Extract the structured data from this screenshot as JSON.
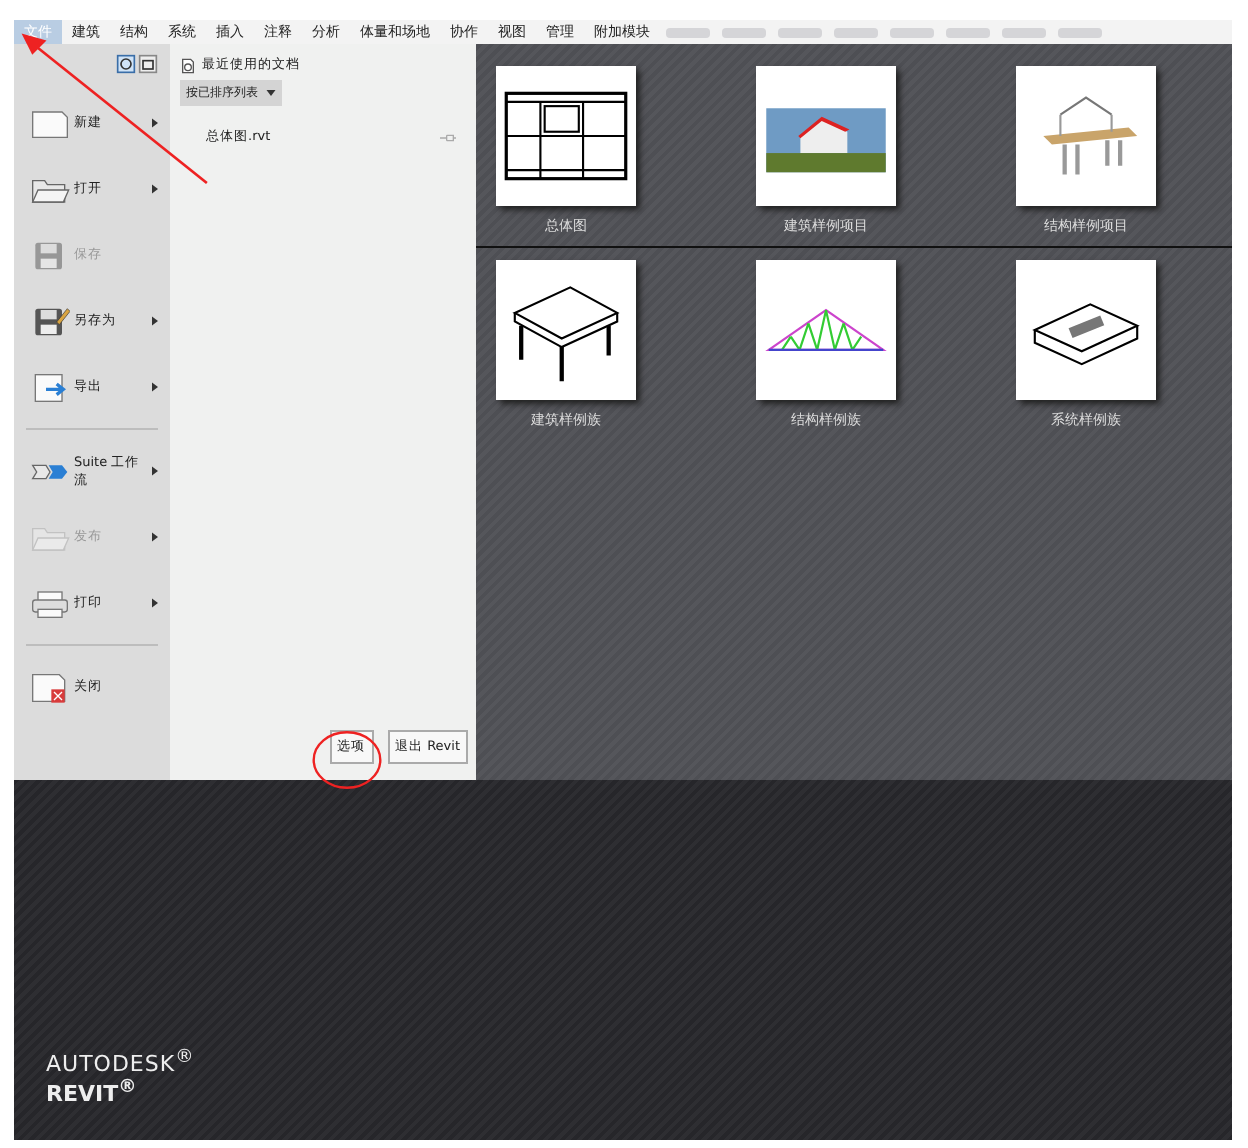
{
  "ribbon": {
    "tabs": [
      {
        "label": "文件",
        "selected": true
      },
      {
        "label": "建筑",
        "selected": false
      },
      {
        "label": "结构",
        "selected": false
      },
      {
        "label": "系统",
        "selected": false
      },
      {
        "label": "插入",
        "selected": false
      },
      {
        "label": "注释",
        "selected": false
      },
      {
        "label": "分析",
        "selected": false
      },
      {
        "label": "体量和场地",
        "selected": false
      },
      {
        "label": "协作",
        "selected": false
      },
      {
        "label": "视图",
        "selected": false
      },
      {
        "label": "管理",
        "selected": false
      },
      {
        "label": "附加模块",
        "selected": false
      }
    ]
  },
  "app_menu": {
    "groups": [
      [
        {
          "label": "新建",
          "disabled": false,
          "submenu": true
        },
        {
          "label": "打开",
          "disabled": false,
          "submenu": true
        },
        {
          "label": "保存",
          "disabled": true,
          "submenu": false
        },
        {
          "label": "另存为",
          "disabled": false,
          "submenu": true
        },
        {
          "label": "导出",
          "disabled": false,
          "submenu": true
        }
      ],
      [
        {
          "label": "Suite 工作流",
          "disabled": false,
          "submenu": true
        },
        {
          "label": "发布",
          "disabled": true,
          "submenu": true
        },
        {
          "label": "打印",
          "disabled": false,
          "submenu": true
        }
      ],
      [
        {
          "label": "关闭",
          "disabled": false,
          "submenu": false
        }
      ]
    ],
    "recent_title": "最近使用的文档",
    "sort_dropdown": "按已排序列表",
    "documents": [
      {
        "name": "总体图.rvt",
        "pinned": false
      }
    ],
    "buttons": [
      "选项",
      "退出 Revit"
    ]
  },
  "start_page": {
    "sections": [
      [
        {
          "label": "总体图",
          "kind": "plan"
        },
        {
          "label": "建筑样例项目",
          "kind": "render"
        },
        {
          "label": "结构样例项目",
          "kind": "frame"
        }
      ],
      [
        {
          "label": "建筑样例族",
          "kind": "table"
        },
        {
          "label": "结构样例族",
          "kind": "truss"
        },
        {
          "label": "系统样例族",
          "kind": "box"
        }
      ]
    ]
  },
  "brand": {
    "company": "AUTODESK$^{®}$",
    "product": "REVIT$^{®}$"
  }
}
